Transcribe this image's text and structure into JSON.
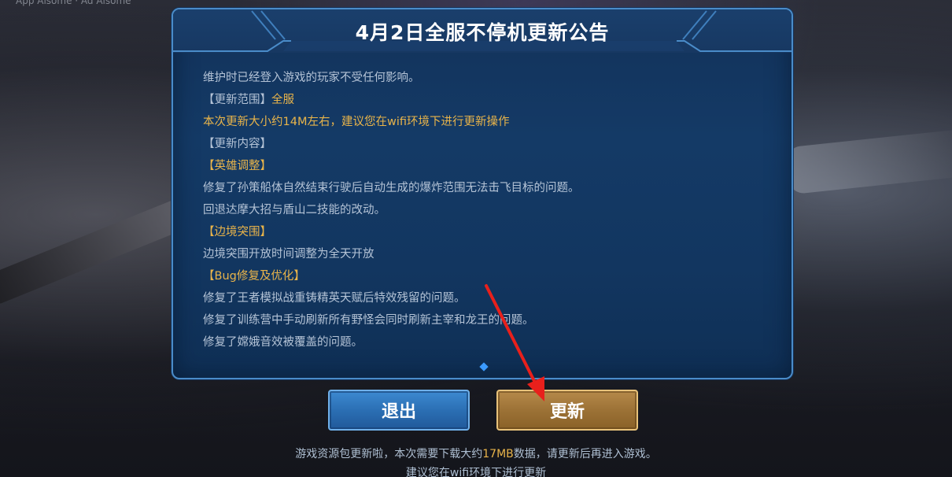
{
  "background": {
    "top_label": "App Alsome · Ad Alsome"
  },
  "notice": {
    "title": "4月2日全服不停机更新公告",
    "lines": [
      {
        "text": "维护时已经登入游戏的玩家不受任何影响。"
      },
      {
        "text": "【更新范围】",
        "gold": "全服"
      },
      {
        "gold": "本次更新大小约14M左右，建议您在wifi环境下进行更新操作"
      },
      {
        "text": "【更新内容】"
      },
      {
        "gold": "【英雄调整】"
      },
      {
        "text": "修复了孙策船体自然结束行驶后自动生成的爆炸范围无法击飞目标的问题。"
      },
      {
        "text": "回退达摩大招与盾山二技能的改动。"
      },
      {
        "gold": "【边境突围】"
      },
      {
        "text": "边境突围开放时间调整为全天开放"
      },
      {
        "gold": "【Bug修复及优化】"
      },
      {
        "text": "修复了王者模拟战重铸精英天赋后特效残留的问题。"
      },
      {
        "text": "修复了训练营中手动刷新所有野怪会同时刷新主宰和龙王的问题。"
      },
      {
        "text": "修复了嫦娥音效被覆盖的问题。"
      }
    ]
  },
  "buttons": {
    "exit_label": "退出",
    "update_label": "更新"
  },
  "footer": {
    "line1_prefix": "游戏资源包更新啦，本次需要下载大约",
    "line1_size": "17MB",
    "line1_suffix": "数据，请更新后再进入游戏。",
    "line2": "建议您在wifi环境下进行更新"
  },
  "colors": {
    "gold_text": "#e9b44a",
    "panel_border": "#4a8cc9",
    "arrow": "#e8201c"
  }
}
